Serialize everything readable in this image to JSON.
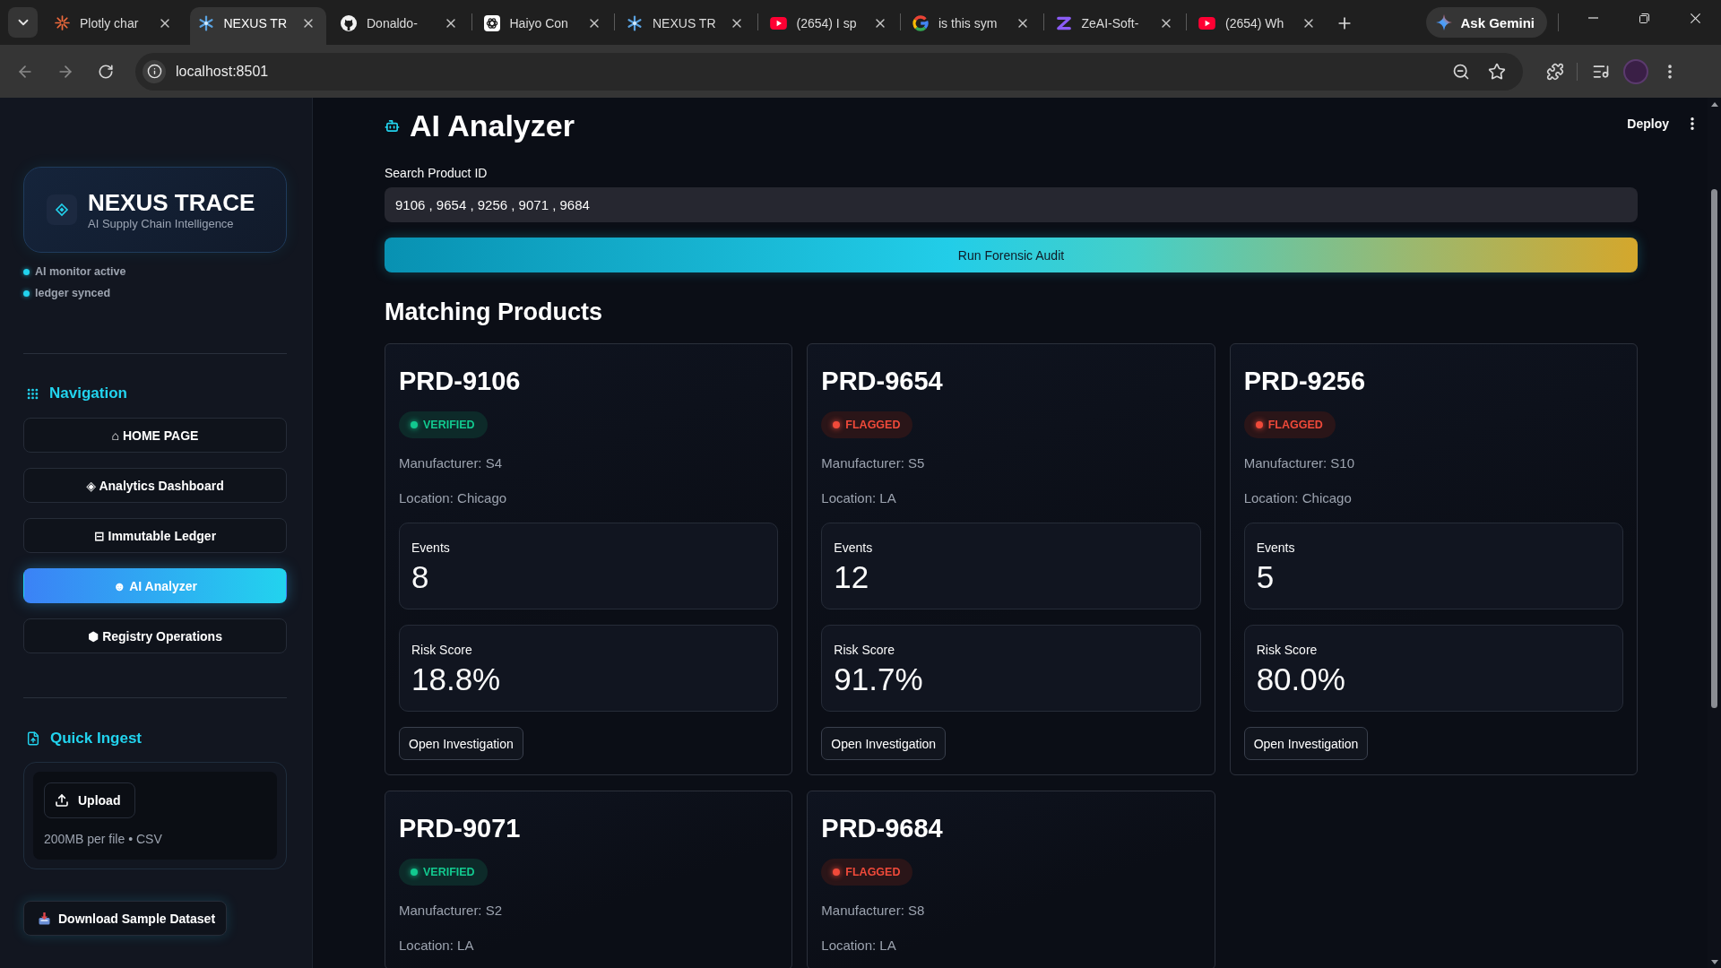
{
  "browser": {
    "tabs": [
      {
        "title": "Plotly char",
        "selected": false
      },
      {
        "title": "NEXUS TR",
        "selected": true
      },
      {
        "title": "Donaldo-",
        "selected": false
      },
      {
        "title": "Haiyo Con",
        "selected": false
      },
      {
        "title": "NEXUS TR",
        "selected": false
      },
      {
        "title": "(2654) I sp",
        "selected": false
      },
      {
        "title": "is this sym",
        "selected": false
      },
      {
        "title": "ZeAI-Soft-",
        "selected": false
      },
      {
        "title": "(2654) Wh",
        "selected": false
      }
    ],
    "gemini_button": "Ask Gemini",
    "address": "localhost:8501"
  },
  "sidebar": {
    "brand": {
      "name": "NEXUS TRACE",
      "tagline": "AI Supply Chain Intelligence"
    },
    "status": [
      "AI monitor active",
      "ledger synced"
    ],
    "navigation": {
      "title": "Navigation",
      "items": [
        {
          "label": "⌂ HOME PAGE",
          "selected": false
        },
        {
          "label": "◈ Analytics Dashboard",
          "selected": false
        },
        {
          "label": "⊟ Immutable Ledger",
          "selected": false
        },
        {
          "label": "☻ AI Analyzer",
          "selected": true
        },
        {
          "label": "⬢ Registry Operations",
          "selected": false
        }
      ]
    },
    "quick_ingest": {
      "title": "Quick Ingest",
      "upload_button": "Upload",
      "limits": "200MB per file • CSV"
    },
    "download_button": "Download Sample Dataset"
  },
  "header": {
    "deploy_button": "Deploy"
  },
  "page": {
    "title": "AI Analyzer",
    "search": {
      "label": "Search Product ID",
      "value": "9106 , 9654 , 9256 , 9071 , 9684"
    },
    "run_button": "Run Forensic Audit",
    "section_title": "Matching Products",
    "products": [
      {
        "id": "PRD-9106",
        "badge": {
          "label": "VERIFIED",
          "kind": "verified"
        },
        "manufacturer": "Manufacturer: S4",
        "location": "Location: Chicago",
        "metrics": [
          {
            "label": "Events",
            "value": "8"
          },
          {
            "label": "Risk Score",
            "value": "18.8%"
          }
        ],
        "action": "Open Investigation"
      },
      {
        "id": "PRD-9654",
        "badge": {
          "label": "FLAGGED",
          "kind": "flagged"
        },
        "manufacturer": "Manufacturer: S5",
        "location": "Location: LA",
        "metrics": [
          {
            "label": "Events",
            "value": "12"
          },
          {
            "label": "Risk Score",
            "value": "91.7%"
          }
        ],
        "action": "Open Investigation"
      },
      {
        "id": "PRD-9256",
        "badge": {
          "label": "FLAGGED",
          "kind": "flagged"
        },
        "manufacturer": "Manufacturer: S10",
        "location": "Location: Chicago",
        "metrics": [
          {
            "label": "Events",
            "value": "5"
          },
          {
            "label": "Risk Score",
            "value": "80.0%"
          }
        ],
        "action": "Open Investigation"
      },
      {
        "id": "PRD-9071",
        "badge": {
          "label": "VERIFIED",
          "kind": "verified"
        },
        "manufacturer": "Manufacturer: S2",
        "location": "Location: LA"
      },
      {
        "id": "PRD-9684",
        "badge": {
          "label": "FLAGGED",
          "kind": "flagged"
        },
        "manufacturer": "Manufacturer: S8",
        "location": "Location: LA"
      }
    ]
  }
}
